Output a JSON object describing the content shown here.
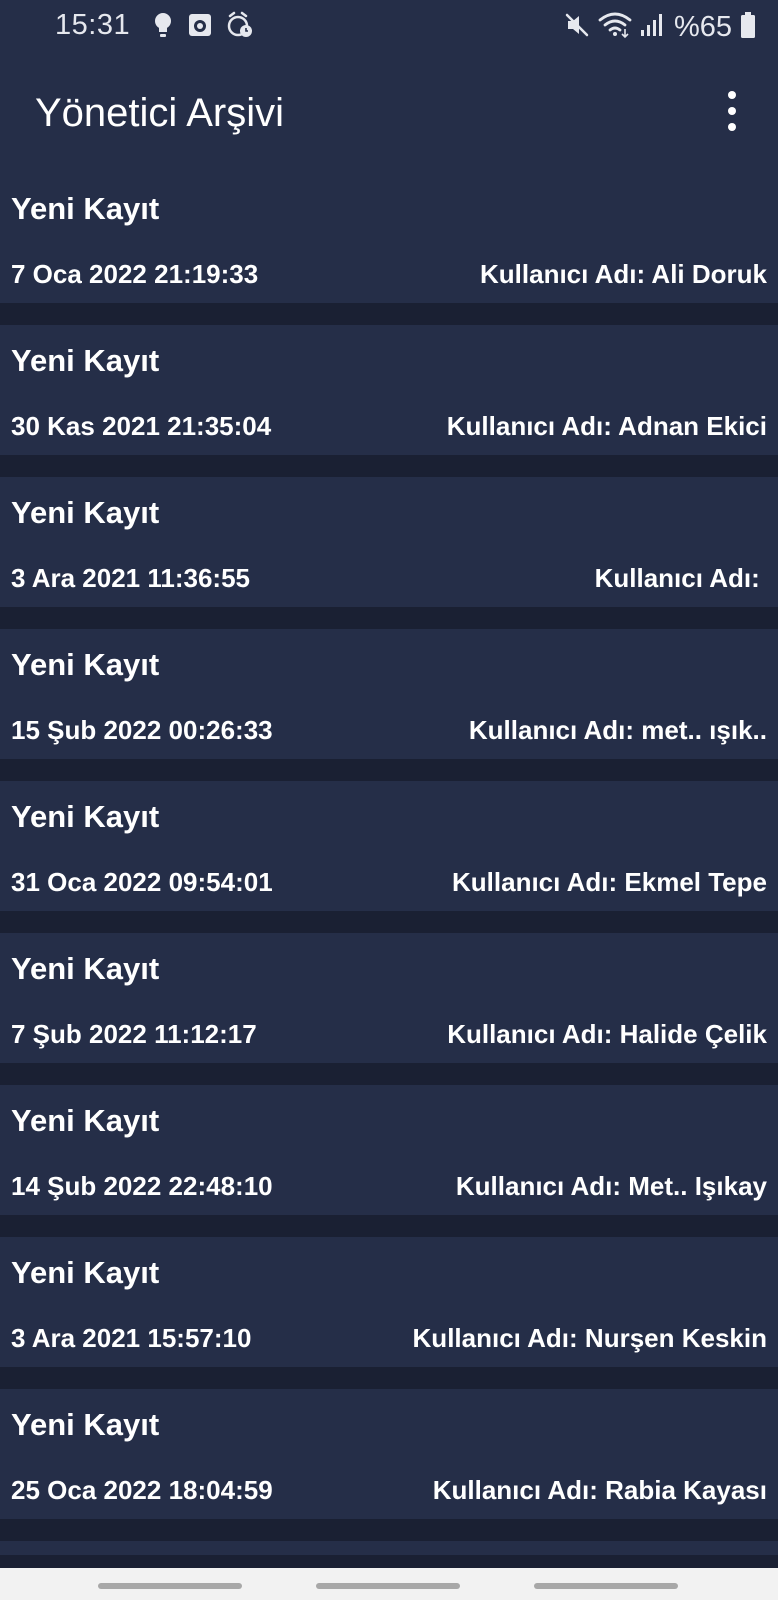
{
  "status_bar": {
    "time": "15:31",
    "battery": "%65",
    "left_icons": [
      "lightbulb-icon",
      "camera-icon",
      "alarm-icon"
    ],
    "right_icons": [
      "mute-icon",
      "wifi-icon",
      "signal-icon",
      "battery-icon"
    ]
  },
  "app_bar": {
    "title": "Yönetici Arşivi",
    "menu_icon": "more-vert-icon"
  },
  "records": [
    {
      "title": "Yeni Kayıt",
      "date": "7 Oca 2022 21:19:33",
      "user_label": "Kullanıcı Adı:",
      "user_name": "Ali Doruk"
    },
    {
      "title": "Yeni Kayıt",
      "date": "30 Kas 2021 21:35:04",
      "user_label": "Kullanıcı Adı:",
      "user_name": "Adnan Ekici"
    },
    {
      "title": "Yeni Kayıt",
      "date": "3 Ara 2021 11:36:55",
      "user_label": "Kullanıcı Adı:",
      "user_name": ""
    },
    {
      "title": "Yeni Kayıt",
      "date": "15 Şub 2022 00:26:33",
      "user_label": "Kullanıcı Adı:",
      "user_name": "met.. ışık.."
    },
    {
      "title": "Yeni Kayıt",
      "date": "31 Oca 2022 09:54:01",
      "user_label": "Kullanıcı Adı:",
      "user_name": "Ekmel Tepe"
    },
    {
      "title": "Yeni Kayıt",
      "date": "7 Şub 2022 11:12:17",
      "user_label": "Kullanıcı Adı:",
      "user_name": "Halide Çelik"
    },
    {
      "title": "Yeni Kayıt",
      "date": "14 Şub 2022 22:48:10",
      "user_label": "Kullanıcı Adı:",
      "user_name": "Met.. Işıkay"
    },
    {
      "title": "Yeni Kayıt",
      "date": "3 Ara 2021 15:57:10",
      "user_label": "Kullanıcı Adı:",
      "user_name": "Nurşen Keskin"
    },
    {
      "title": "Yeni Kayıt",
      "date": "25 Oca 2022 18:04:59",
      "user_label": "Kullanıcı Adı:",
      "user_name": "Rabia Kayası"
    }
  ],
  "colors": {
    "background": "#1a2033",
    "card": "#252e48",
    "text": "#ffffff",
    "nav_bar": "#f2f2f2"
  }
}
